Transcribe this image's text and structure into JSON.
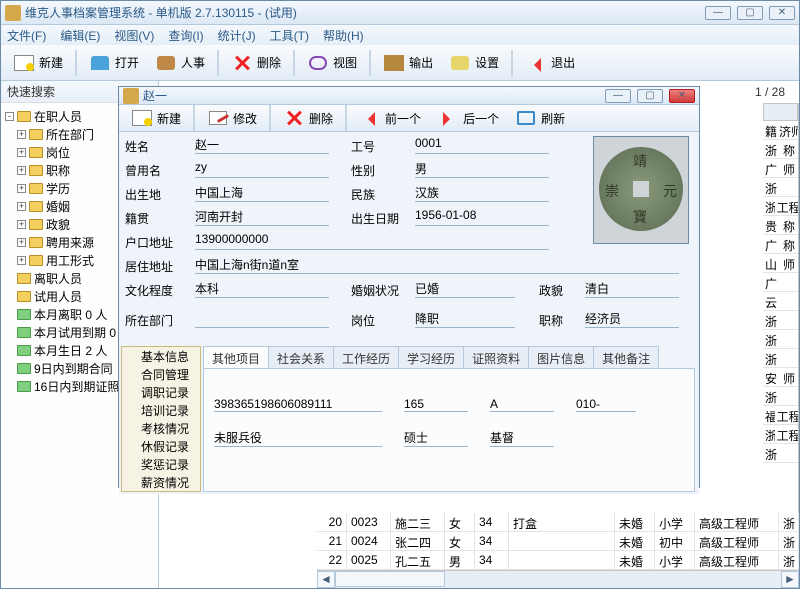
{
  "app": {
    "title": "维克人事档案管理系统 - 单机版 2.7.130115 - (试用)"
  },
  "menus": [
    "文件(F)",
    "编辑(E)",
    "视图(V)",
    "查询(I)",
    "统计(J)",
    "工具(T)",
    "帮助(H)"
  ],
  "toolbar": [
    "新建",
    "打开",
    "人事",
    "删除",
    "视图",
    "输出",
    "设置",
    "退出"
  ],
  "quicksearch": "快速搜索",
  "tree": [
    {
      "lvl": 0,
      "exp": "-",
      "g": false,
      "t": "在职人员"
    },
    {
      "lvl": 1,
      "exp": "+",
      "g": false,
      "t": "所在部门"
    },
    {
      "lvl": 1,
      "exp": "+",
      "g": false,
      "t": "岗位"
    },
    {
      "lvl": 1,
      "exp": "+",
      "g": false,
      "t": "职称"
    },
    {
      "lvl": 1,
      "exp": "+",
      "g": false,
      "t": "学历"
    },
    {
      "lvl": 1,
      "exp": "+",
      "g": false,
      "t": "婚姻"
    },
    {
      "lvl": 1,
      "exp": "+",
      "g": false,
      "t": "政貌"
    },
    {
      "lvl": 1,
      "exp": "+",
      "g": false,
      "t": "聘用来源"
    },
    {
      "lvl": 1,
      "exp": "+",
      "g": false,
      "t": "用工形式"
    },
    {
      "lvl": 0,
      "exp": "",
      "g": false,
      "t": "离职人员"
    },
    {
      "lvl": 0,
      "exp": "",
      "g": false,
      "t": "试用人员"
    },
    {
      "lvl": 0,
      "exp": "",
      "g": true,
      "t": "本月离职 0 人"
    },
    {
      "lvl": 0,
      "exp": "",
      "g": true,
      "t": "本月试用到期 0"
    },
    {
      "lvl": 0,
      "exp": "",
      "g": true,
      "t": "本月生日 2 人"
    },
    {
      "lvl": 0,
      "exp": "",
      "g": true,
      "t": "9日内到期合同"
    },
    {
      "lvl": 0,
      "exp": "",
      "g": true,
      "t": "16日内到期证照"
    }
  ],
  "counter": "1 / 28",
  "rightcol": [
    "籍",
    "济师",
    "浙",
    "称",
    "广",
    "师",
    "浙",
    "",
    "浙",
    "工程师",
    "贵",
    "称",
    "广",
    "称",
    "山",
    "师",
    "广",
    "",
    "云",
    "",
    "浙",
    "",
    "浙",
    "",
    "浙",
    "",
    "安",
    "师",
    "浙",
    "",
    "福",
    "工程师",
    "浙",
    "工程师",
    "浙"
  ],
  "bottomrows": [
    {
      "n": "20",
      "id": "0023",
      "nm": "施二三",
      "sx": "女",
      "ag": "34",
      "sp": "打盒",
      "ms": "未婚",
      "ed": "小学",
      "ti": "高级工程师",
      "px": "浙"
    },
    {
      "n": "21",
      "id": "0024",
      "nm": "张二四",
      "sx": "女",
      "ag": "34",
      "sp": "",
      "ms": "未婚",
      "ed": "初中",
      "ti": "高级工程师",
      "px": "浙"
    },
    {
      "n": "22",
      "id": "0025",
      "nm": "孔二五",
      "sx": "男",
      "ag": "34",
      "sp": "",
      "ms": "未婚",
      "ed": "小学",
      "ti": "高级工程师",
      "px": "浙"
    }
  ],
  "detail": {
    "title": "赵一",
    "toolbar": [
      "新建",
      "修改",
      "删除",
      "前一个",
      "后一个",
      "刷新"
    ],
    "labels": {
      "name": "姓名",
      "emp": "工号",
      "alias": "曾用名",
      "sex": "性别",
      "birthplace": "出生地",
      "ethnic": "民族",
      "native": "籍贯",
      "dob": "出生日期",
      "hukou": "户口地址",
      "addr": "居住地址",
      "edu": "文化程度",
      "marital": "婚姻状况",
      "pol": "政貌",
      "dept": "所在部门",
      "post": "岗位",
      "title": "职称"
    },
    "values": {
      "name": "赵一",
      "emp": "0001",
      "alias": "zy",
      "sex": "男",
      "birthplace": "中国上海",
      "ethnic": "汉族",
      "native": "河南开封",
      "dob": "1956-01-08",
      "hukou": "13900000000",
      "addr": "中国上海n街n道n室",
      "edu": "本科",
      "marital": "已婚",
      "pol": "清白",
      "dept": "",
      "post": "降职",
      "title": "经济员"
    },
    "coin": [
      "靖",
      "元",
      "寶",
      "崇"
    ],
    "sidelist": [
      "基本信息",
      "合同管理",
      "调职记录",
      "培训记录",
      "考核情况",
      "休假记录",
      "奖惩记录",
      "薪资情况"
    ],
    "tabs": [
      "其他项目",
      "社会关系",
      "工作经历",
      "学习经历",
      "证照资料",
      "图片信息",
      "其他备注"
    ],
    "tabdata": {
      "r1": [
        "398365198606089111",
        "165",
        "A",
        "010-"
      ],
      "r2": [
        "未服兵役",
        "硕士",
        "基督"
      ]
    }
  }
}
